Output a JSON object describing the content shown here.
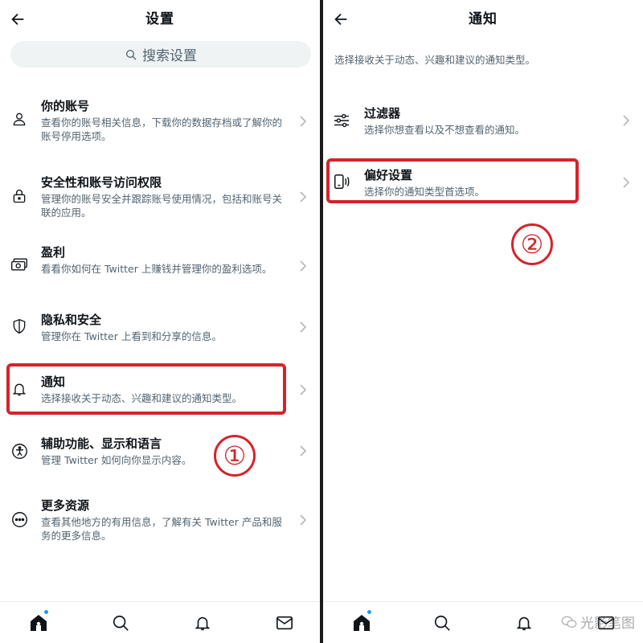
{
  "left": {
    "title": "设置",
    "search_placeholder": "搜索设置",
    "items": [
      {
        "title": "你的账号",
        "desc": "查看你的账号相关信息，下载你的数据存档或了解你的账号停用选项。",
        "icon": "person-icon"
      },
      {
        "title": "安全性和账号访问权限",
        "desc": "管理你的账号安全并跟踪账号使用情况，包括和账号关联的应用。",
        "icon": "lock-icon"
      },
      {
        "title": "盈利",
        "desc": "看看你如何在 Twitter 上赚钱并管理你的盈利选项。",
        "icon": "money-icon"
      },
      {
        "title": "隐私和安全",
        "desc": "管理你在 Twitter 上看到和分享的信息。",
        "icon": "shield-icon"
      },
      {
        "title": "通知",
        "desc": "选择接收关于动态、兴趣和建议的通知类型。",
        "icon": "bell-icon"
      },
      {
        "title": "辅助功能、显示和语言",
        "desc": "管理 Twitter 如何向你显示内容。",
        "icon": "accessibility-icon"
      },
      {
        "title": "更多资源",
        "desc": "查看其他地方的有用信息，了解有关 Twitter 产品和服务的更多信息。",
        "icon": "more-icon"
      }
    ],
    "annotation": "①"
  },
  "right": {
    "title": "通知",
    "subtitle": "选择接收关于动态、兴趣和建议的通知类型。",
    "items": [
      {
        "title": "过滤器",
        "desc": "选择你想查看以及不想查看的通知。",
        "icon": "filter-sliders-icon"
      },
      {
        "title": "偏好设置",
        "desc": "选择你的通知类型首选项。",
        "icon": "phone-notification-icon"
      }
    ],
    "annotation": "②"
  },
  "tabbar": [
    "home-icon",
    "search-icon",
    "bell-icon",
    "mail-icon"
  ],
  "watermark": "光影笔图",
  "colors": {
    "highlight": "#d5232b",
    "accent": "#1d9bf0",
    "secondary_text": "#536471"
  }
}
